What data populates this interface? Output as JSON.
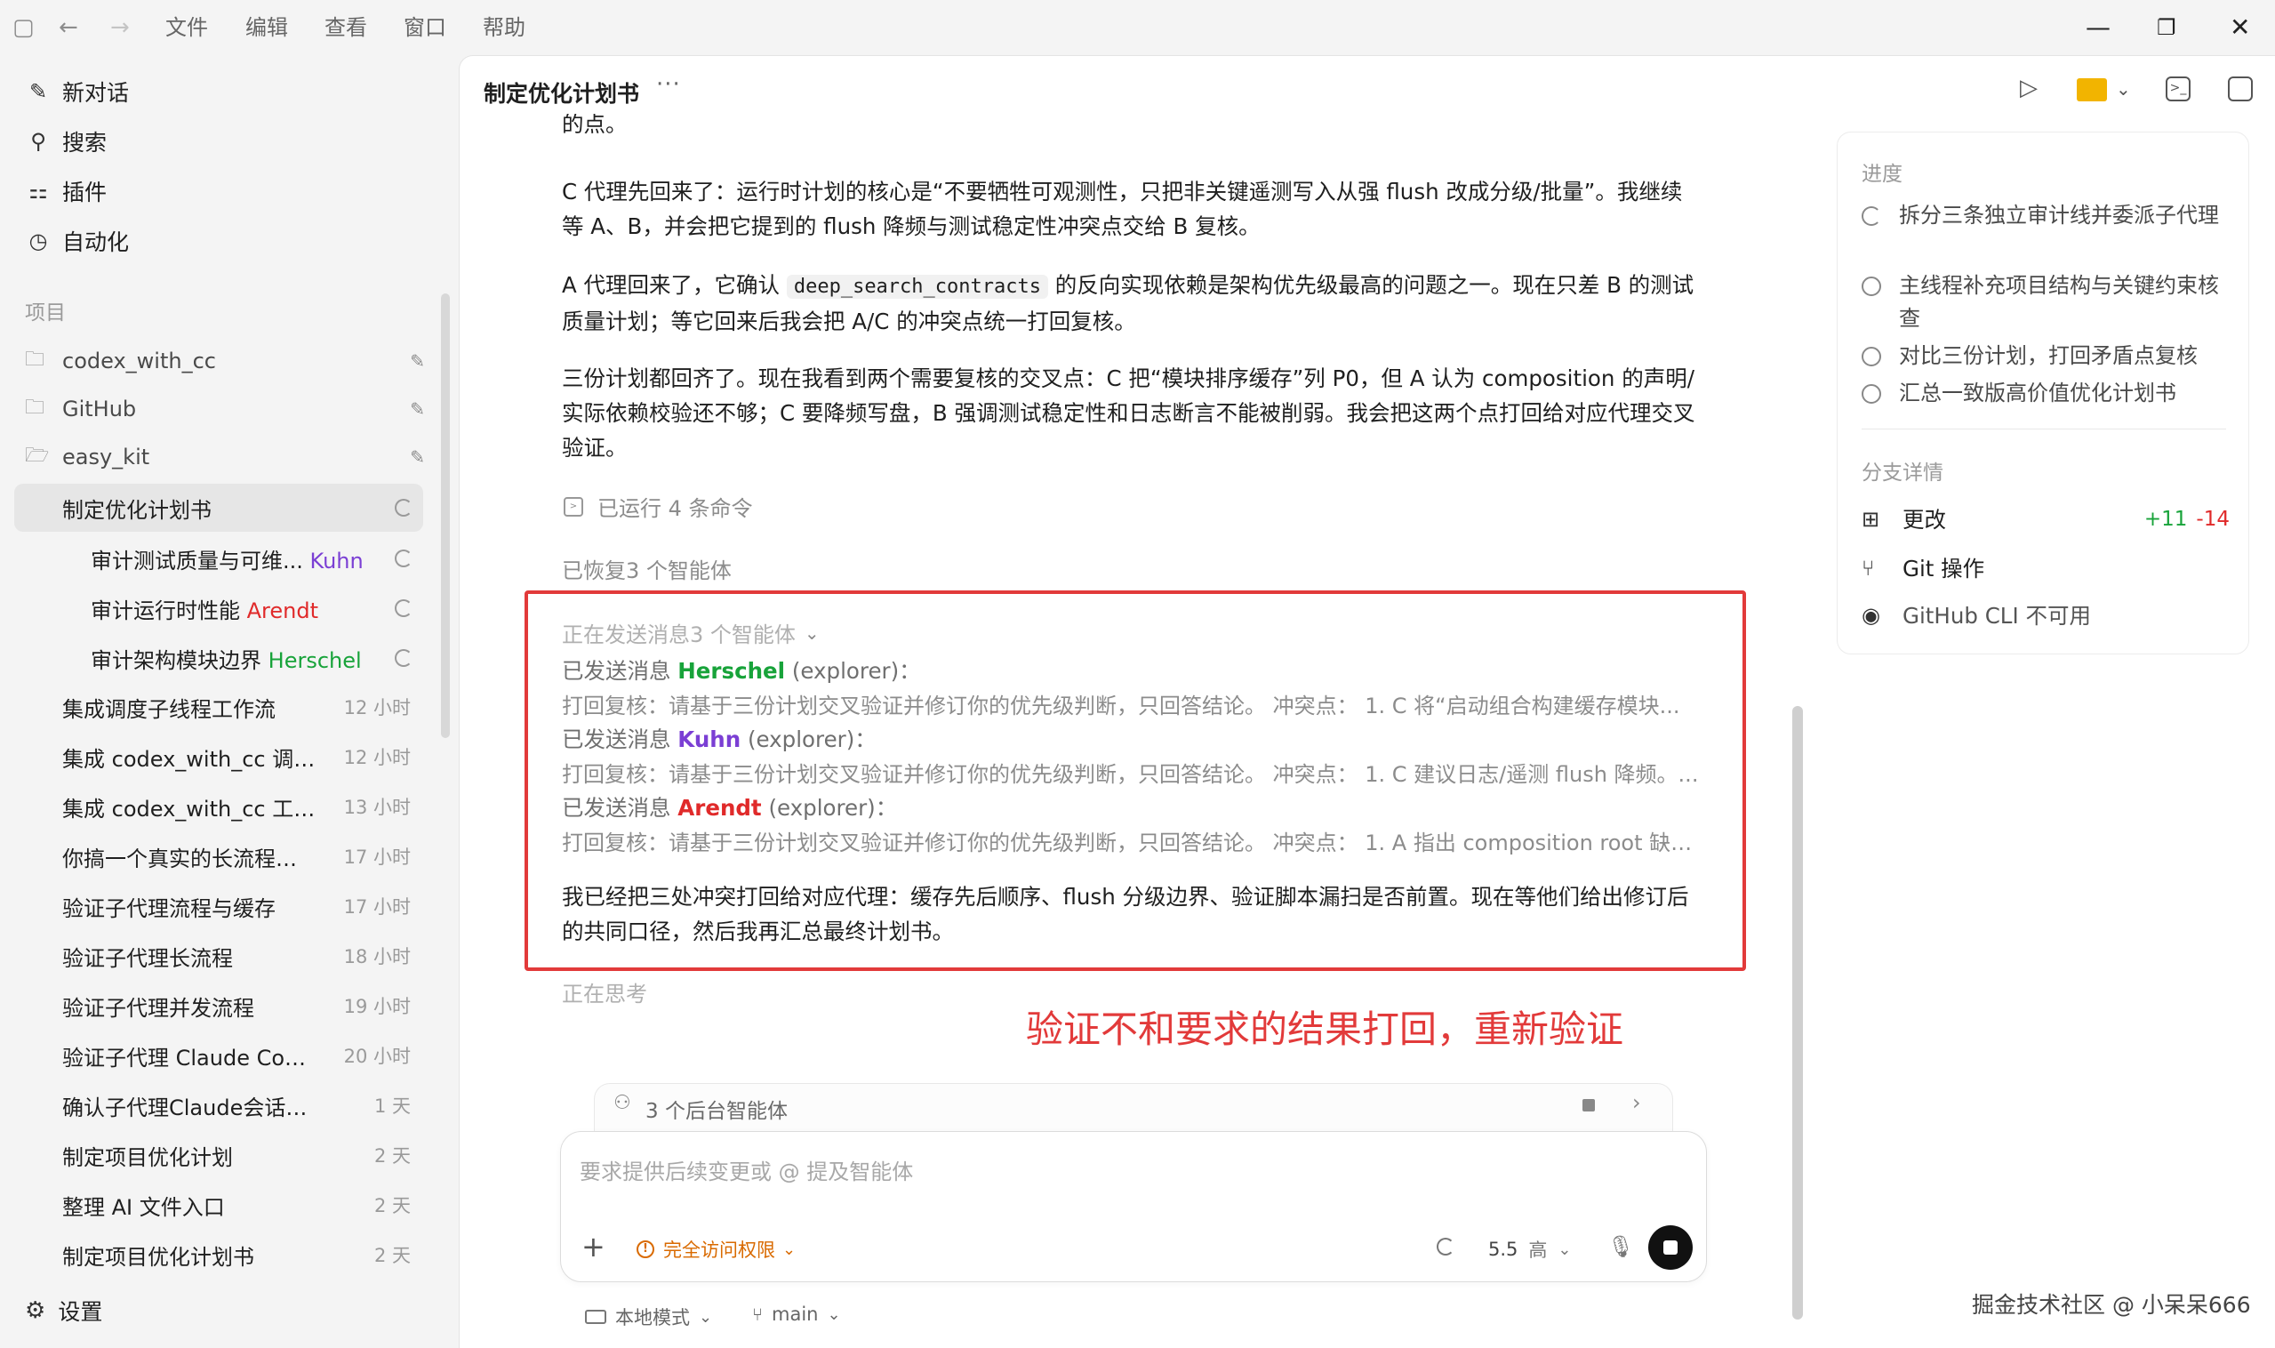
{
  "menu": [
    "文件",
    "编辑",
    "查看",
    "窗口",
    "帮助"
  ],
  "sidebar": {
    "nav": [
      {
        "label": "新对话",
        "icon": "new-chat-icon"
      },
      {
        "label": "搜索",
        "icon": "search-icon"
      },
      {
        "label": "插件",
        "icon": "plugins-icon"
      },
      {
        "label": "自动化",
        "icon": "clock-icon"
      }
    ],
    "section_label": "项目",
    "projects": [
      "codex_with_cc",
      "GitHub",
      "easy_kit"
    ],
    "active_chat": "制定优化计划书",
    "subagents": [
      {
        "title": "审计测试质量与可维...",
        "agent": "Kuhn",
        "color": "#7b3fd4"
      },
      {
        "title": "审计运行时性能",
        "agent": "Arendt",
        "color": "#e02a2a"
      },
      {
        "title": "审计架构模块边界",
        "agent": "Herschel",
        "color": "#18a33a"
      }
    ],
    "chats": [
      {
        "title": "集成调度子线程工作流",
        "time": "12 小时"
      },
      {
        "title": "集成 codex_with_cc 调度工...",
        "time": "12 小时"
      },
      {
        "title": "集成 codex_with_cc 工作流",
        "time": "13 小时"
      },
      {
        "title": "你搞一个真实的长流程复杂...",
        "time": "17 小时"
      },
      {
        "title": "验证子代理流程与缓存",
        "time": "17 小时"
      },
      {
        "title": "验证子代理长流程",
        "time": "18 小时"
      },
      {
        "title": "验证子代理并发流程",
        "time": "19 小时"
      },
      {
        "title": "验证子代理 Claude Code CLI",
        "time": "20 小时"
      },
      {
        "title": "确认子代理Claude会话复用",
        "time": "1 天"
      },
      {
        "title": "制定项目优化计划",
        "time": "2 天"
      },
      {
        "title": "整理 AI 文件入口",
        "time": "2 天"
      },
      {
        "title": "制定项目优化计划书",
        "time": "2 天"
      }
    ],
    "settings": "设置"
  },
  "main": {
    "title": "制定优化计划书",
    "cut_text": "的点。",
    "para1": "C 代理先回来了：运行时计划的核心是“不要牺牲可观测性，只把非关键遥测写入从强 flush 改成分级/批量”。我继续等 A、B，并会把它提到的 flush 降频与测试稳定性冲突点交给 B 复核。",
    "para2_a": "A 代理回来了，它确认 ",
    "para2_code": "deep_search_contracts",
    "para2_b": " 的反向实现依赖是架构优先级最高的问题之一。现在只差 B 的测试质量计划；等它回来后我会把 A/C 的冲突点统一打回复核。",
    "para3": "三份计划都回齐了。现在我看到两个需要复核的交叉点：C 把“模块排序缓存”列 P0，但 A 认为 composition 的声明/实际依赖校验还不够；C 要降频写盘，B 强调测试稳定性和日志断言不能被削弱。我会把这两个点打回给对应代理交叉验证。",
    "ran_commands": "已运行 4 条命令",
    "restored": "已恢复3 个智能体",
    "sending": "正在发送消息3 个智能体",
    "sent_prefix": "已发送消息",
    "agent_role": "(explorer)：",
    "sent": [
      {
        "name": "Herschel",
        "color": "#18a33a",
        "detail": "打回复核：请基于三份计划交叉验证并修订你的优先级判断，只回答结论。 冲突点： 1. C 将“启动组合构建缓存模块..."
      },
      {
        "name": "Kuhn",
        "color": "#7b3fd4",
        "detail": "打回复核：请基于三份计划交叉验证并修订你的优先级判断，只回答结论。 冲突点： 1. C 建议日志/遥测 flush 降频。..."
      },
      {
        "name": "Arendt",
        "color": "#e02a2a",
        "detail": "打回复核：请基于三份计划交叉验证并修订你的优先级判断，只回答结论。 冲突点： 1. A 指出 composition root 缺少..."
      }
    ],
    "summary": "我已经把三处冲突打回给对应代理：缓存先后顺序、flush 分级边界、验证脚本漏扫是否前置。现在等他们给出修订后的共同口径，然后我再汇总最终计划书。",
    "thinking": "正在思考",
    "annotation": "验证不和要求的结果打回，重新验证",
    "bg_agents": "3 个后台智能体",
    "composer_placeholder": "要求提供后续变更或 @ 提及智能体",
    "access": "完全访问权限",
    "model": "5.5",
    "effort": "高",
    "mode": "本地模式",
    "branch": "main"
  },
  "right": {
    "progress_label": "进度",
    "todos": [
      {
        "text": "拆分三条独立审计线并委派子代理",
        "running": true
      },
      {
        "text": "主线程补充项目结构与关键约束核查",
        "running": false
      },
      {
        "text": "对比三份计划，打回矛盾点复核",
        "running": false
      },
      {
        "text": "汇总一致版高价值优化计划书",
        "running": false
      }
    ],
    "branch_label": "分支详情",
    "changes": "更改",
    "added": "+11",
    "removed": "-14",
    "git": "Git 操作",
    "gh": "GitHub CLI 不可用"
  },
  "watermark": "掘金技术社区 @ 小呆呆666"
}
